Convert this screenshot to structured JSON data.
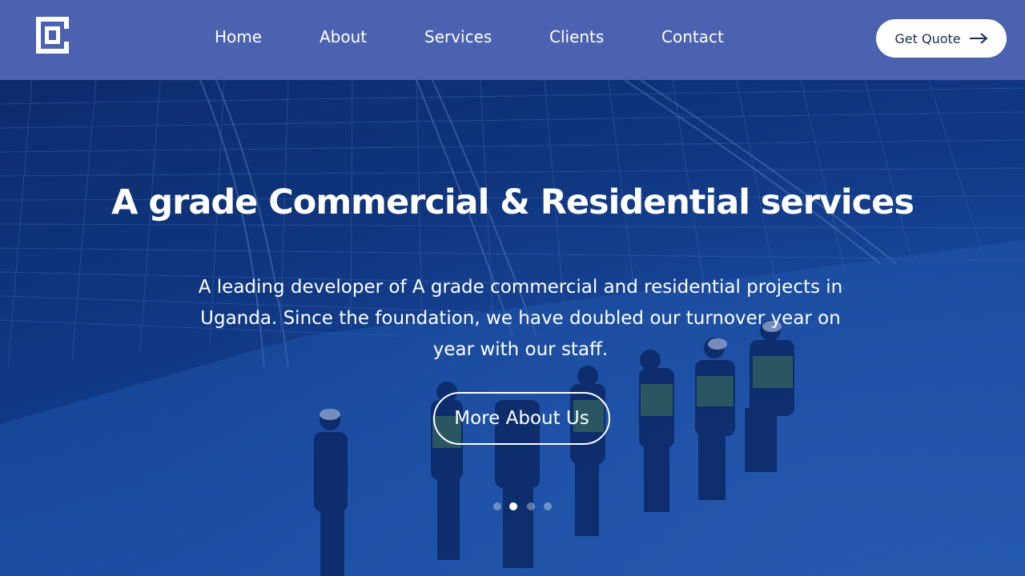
{
  "header": {
    "logo_icon": "square-frame-logo-icon",
    "nav": [
      {
        "label": "Home"
      },
      {
        "label": "About"
      },
      {
        "label": "Services"
      },
      {
        "label": "Clients"
      },
      {
        "label": "Contact"
      }
    ],
    "cta_label": "Get Quote",
    "cta_icon": "arrow-right-icon"
  },
  "hero": {
    "title": "A grade Commercial & Residential services",
    "text": "A leading developer of A grade commercial and residential projects in Uganda. Since the foundation, we have doubled our turnover year on year with our staff.",
    "button_label": "More About Us",
    "slides_total": 4,
    "active_slide": 2
  },
  "colors": {
    "header_bg": "#4b62b0",
    "hero_tint": "#12408f",
    "cta_text": "#1c2b55",
    "white": "#ffffff"
  }
}
